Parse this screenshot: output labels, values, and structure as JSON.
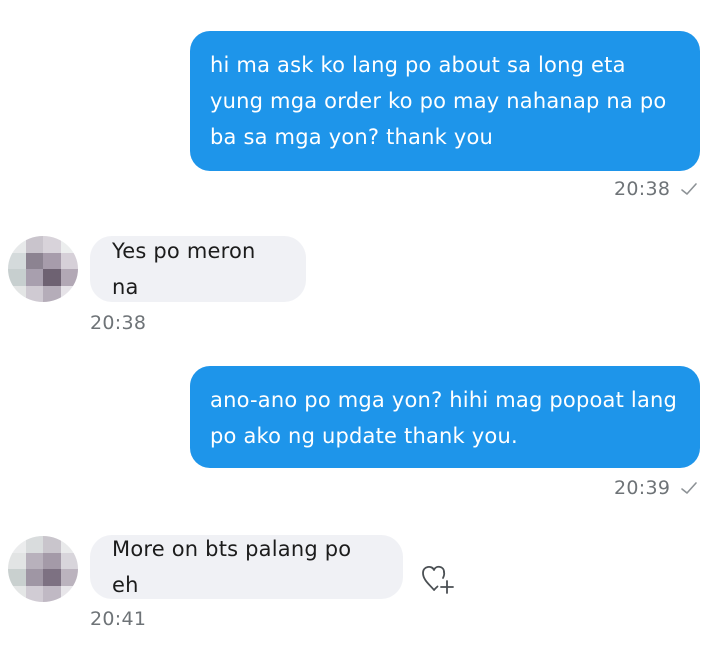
{
  "messages": [
    {
      "direction": "outgoing",
      "lines": [
        "hi ma ask ko lang po about sa long eta",
        "yung mga order ko po may nahanap na po",
        "ba sa mga yon? thank you"
      ],
      "time": "20:38",
      "status": "sent"
    },
    {
      "direction": "incoming",
      "text": "Yes po meron na",
      "time": "20:38"
    },
    {
      "direction": "outgoing",
      "lines": [
        "ano-ano po mga yon? hihi mag popoat lang",
        "po ako ng update thank you."
      ],
      "time": "20:39",
      "status": "sent"
    },
    {
      "direction": "incoming",
      "text": "More on bts palang po eh",
      "time": "20:41"
    }
  ],
  "colors": {
    "outgoing_bubble": "#1e95ea",
    "incoming_bubble": "#f0f1f5",
    "timestamp": "#6e7377"
  },
  "icons": {
    "status": "check-icon",
    "avatar": "blurred-avatar",
    "reaction": "heart-plus-icon"
  }
}
